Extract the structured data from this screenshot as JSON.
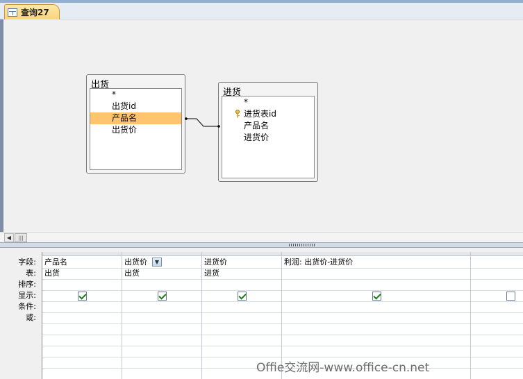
{
  "tab": {
    "label": "查询27",
    "icon": "query-icon"
  },
  "tables": [
    {
      "title": "出货",
      "fields": [
        "*",
        "出货id",
        "产品名",
        "出货价"
      ],
      "selected_field": "产品名"
    },
    {
      "title": "进货",
      "fields": [
        "*",
        "进货表id",
        "产品名",
        "进货价"
      ],
      "key_field": "进货表id"
    }
  ],
  "grid": {
    "row_labels": [
      "字段:",
      "表:",
      "排序:",
      "显示:",
      "条件:",
      "或:"
    ],
    "columns": [
      {
        "field": "产品名",
        "table": "出货",
        "sort": "",
        "show": true
      },
      {
        "field": "出货价",
        "table": "出货",
        "sort": "",
        "show": true
      },
      {
        "field": "进货价",
        "table": "进货",
        "sort": "",
        "show": true
      },
      {
        "field": "利润: 出货价-进货价",
        "table": "",
        "sort": "",
        "show": true
      },
      {
        "field": "",
        "table": "",
        "sort": "",
        "show": false
      }
    ]
  },
  "colors": {
    "selected": "#ffc56e",
    "accent": "#f9d47a"
  },
  "watermark": "Offie交流网-www.office-cn.net"
}
